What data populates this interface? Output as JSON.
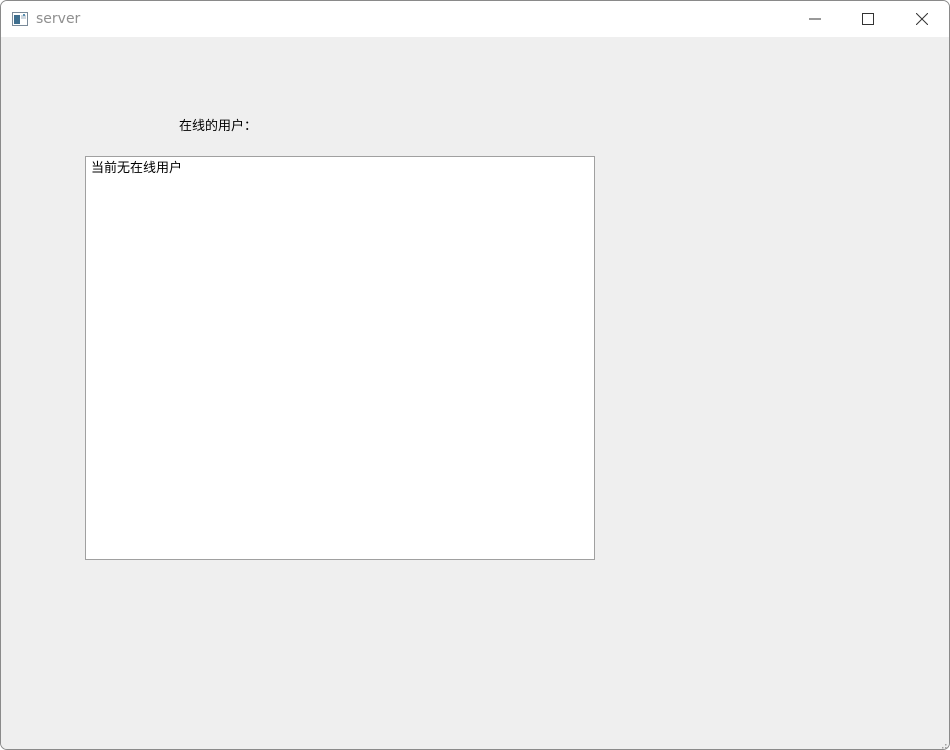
{
  "window": {
    "title": "server",
    "icon": "app-window-icon",
    "controls": [
      "minimize-icon",
      "maximize-icon",
      "close-icon"
    ]
  },
  "main": {
    "online_users_label": "在线的用户：",
    "user_list": {
      "items": [
        "当前无在线用户"
      ]
    }
  },
  "colors": {
    "client_background": "#efefef",
    "titlebar_background": "#ffffff",
    "list_background": "#ffffff",
    "list_border": "#a0a0a0",
    "title_text": "#8f8f8f"
  }
}
